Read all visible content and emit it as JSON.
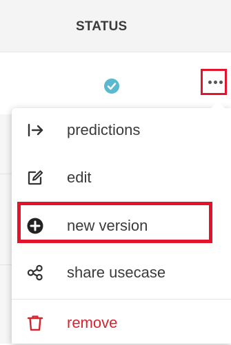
{
  "table": {
    "status_header": "STATUS"
  },
  "row": {
    "status_icon": "check-circle-icon",
    "more_icon": "more-horizontal-icon"
  },
  "menu": {
    "items": [
      {
        "label": "predictions",
        "icon": "arrow-right-to-line-icon"
      },
      {
        "label": "edit",
        "icon": "edit-icon"
      },
      {
        "label": "new version",
        "icon": "plus-circle-icon"
      },
      {
        "label": "share usecase",
        "icon": "share-icon"
      },
      {
        "label": "remove",
        "icon": "trash-icon"
      }
    ]
  },
  "colors": {
    "header_bg": "#f4f4f5",
    "status_check": "#5ab8cf",
    "highlight_border": "#e3132b",
    "danger_text": "#d8242f",
    "text": "#3a3a3a"
  }
}
